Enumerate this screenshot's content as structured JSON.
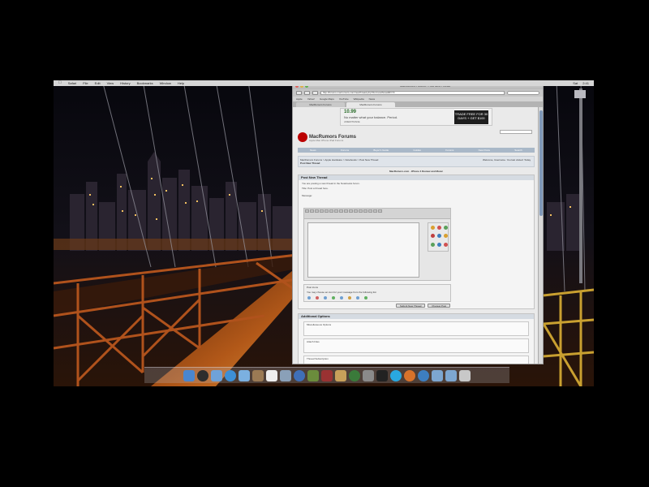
{
  "menubar": {
    "apple_icon": "apple-icon",
    "items": [
      "Safari",
      "File",
      "Edit",
      "View",
      "History",
      "Bookmarks",
      "Window",
      "Help"
    ],
    "status": [
      "Sat",
      "2:41"
    ]
  },
  "browser": {
    "window_title": "MacRumors Forums - Post New Thread",
    "url": "http://forums.macrumors.com/newthread.php?do=newthread&f=73",
    "bookmarks": [
      "Apple",
      "Yahoo!",
      "Google Maps",
      "YouTube",
      "Wikipedia",
      "News"
    ],
    "tabs": [
      "MacRumors Forums",
      "MacRumors Forums"
    ]
  },
  "ad": {
    "headline": "10.99",
    "subline": "No matter what your balance. Period.",
    "brand": "AMERITRADE",
    "cta": "TRADE FREE FOR 30 DAYS + GET $100"
  },
  "site": {
    "name": "MacRumors Forums",
    "tagline": "Apple Mac iPhone iPad Forums"
  },
  "nav": [
    "News",
    "Forums",
    "Buyer's Guide",
    "Guides",
    "Forums",
    "New Posts",
    "Search"
  ],
  "breadcrumb": {
    "path": "MacRumors Forums > Apple Hardware > Notebooks > Post New Thread",
    "title": "Post New Thread",
    "welcome": "Welcome, Username. You last visited: Today"
  },
  "announcement": "MacRumors.com - iPhone 4 Review and Music",
  "post_panel": {
    "title": "Post New Thread",
    "line1": "You are posting a new thread in the Notebooks forum.",
    "line2": "Title: Post a thread here.",
    "message_label": "Message:",
    "options_label": "Post Icons",
    "options_text": "You may choose an icon for your message from the following list:",
    "buttons": [
      "Submit New Thread",
      "Preview Post"
    ]
  },
  "additional": {
    "title": "Additional Options",
    "box1_label": "Miscellaneous Options",
    "box2_label": "Attach Files",
    "box3_label": "Thread Subscription"
  },
  "dock_icons": [
    "finder-icon",
    "dashboard-icon",
    "mail-icon",
    "safari-icon",
    "ichat-icon",
    "address-book-icon",
    "ical-icon",
    "preview-icon",
    "itunes-icon",
    "iphoto-icon",
    "imovie-icon",
    "garageband-icon",
    "time-machine-icon",
    "system-preferences-icon",
    "terminal-icon",
    "skype-icon",
    "firefox-icon",
    "app-store-icon",
    "folder-icon",
    "downloads-icon",
    "trash-icon"
  ],
  "colors": {
    "accent": "#a9b8c8",
    "logo": "#bb0000",
    "ad_green": "#2b6d2b"
  }
}
